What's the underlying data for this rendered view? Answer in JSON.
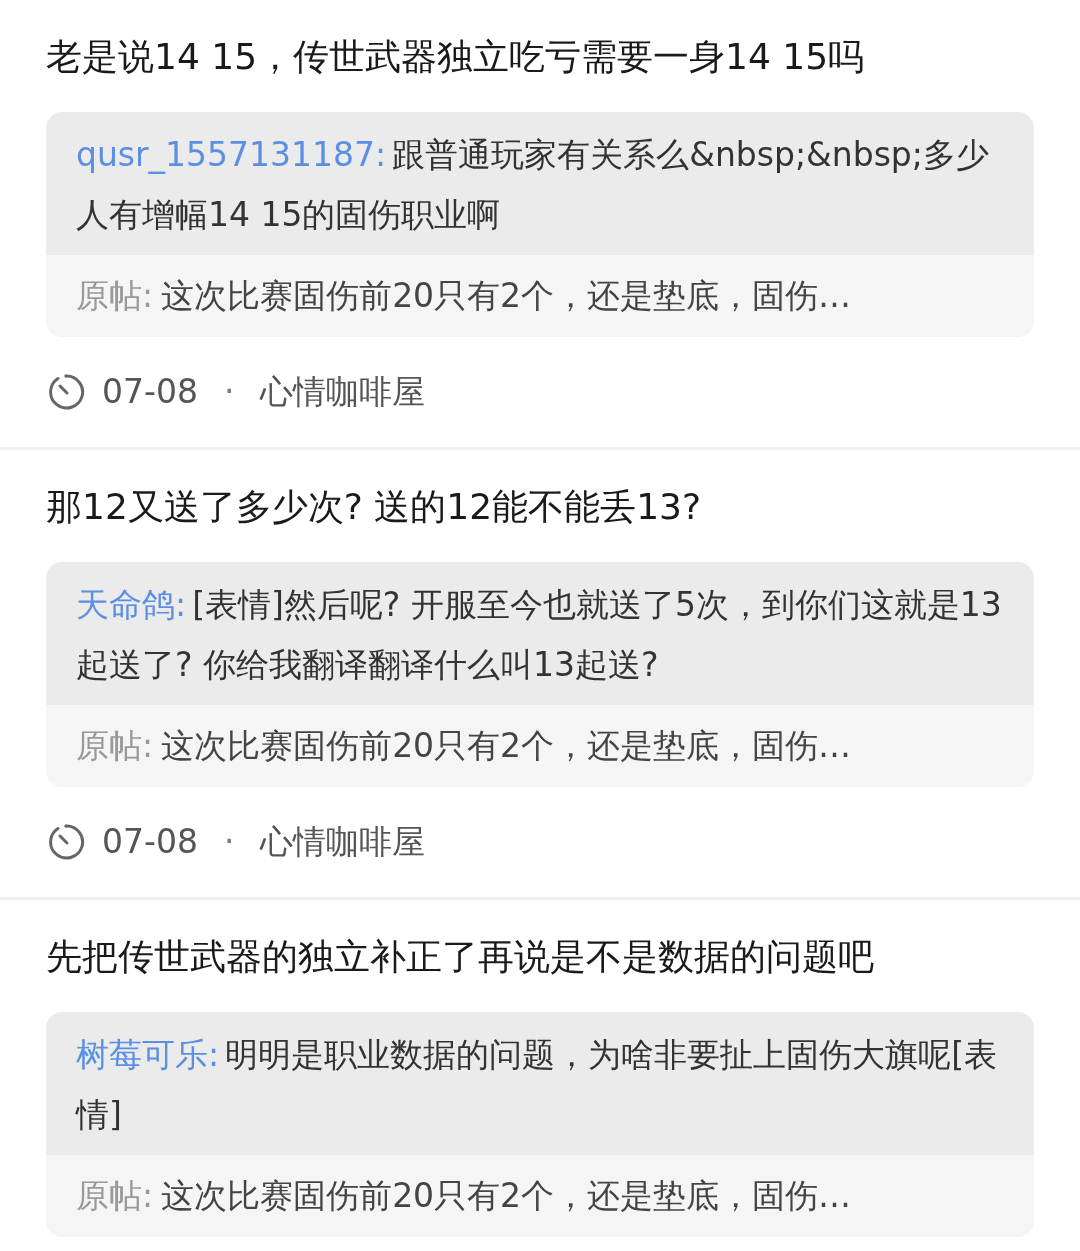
{
  "posts": [
    {
      "title": "老是说14 15，传世武器独立吃亏需要一身14 15吗",
      "reply": {
        "author": "qusr_1557131187:",
        "text": "跟普通玩家有关系么&nbsp;&nbsp;多少人有增幅14 15的固伤职业啊"
      },
      "original": {
        "label": "原帖:",
        "text": "这次比赛固伤前20只有2个，还是垫底，固伤…"
      },
      "date": "07-08",
      "separator": "·",
      "forum": "心情咖啡屋"
    },
    {
      "title": "那12又送了多少次? 送的12能不能丢13?",
      "reply": {
        "author": "天命鸽:",
        "text": "[表情]然后呢? 开服至今也就送了5次，到你们这就是13起送了? 你给我翻译翻译什么叫13起送?"
      },
      "original": {
        "label": "原帖:",
        "text": "这次比赛固伤前20只有2个，还是垫底，固伤…"
      },
      "date": "07-08",
      "separator": "·",
      "forum": "心情咖啡屋"
    },
    {
      "title": "先把传世武器的独立补正了再说是不是数据的问题吧",
      "reply": {
        "author": "树莓可乐:",
        "text": "明明是职业数据的问题，为啥非要扯上固伤大旗呢[表情]"
      },
      "original": {
        "label": "原帖:",
        "text": "这次比赛固伤前20只有2个，还是垫底，固伤…"
      }
    }
  ]
}
